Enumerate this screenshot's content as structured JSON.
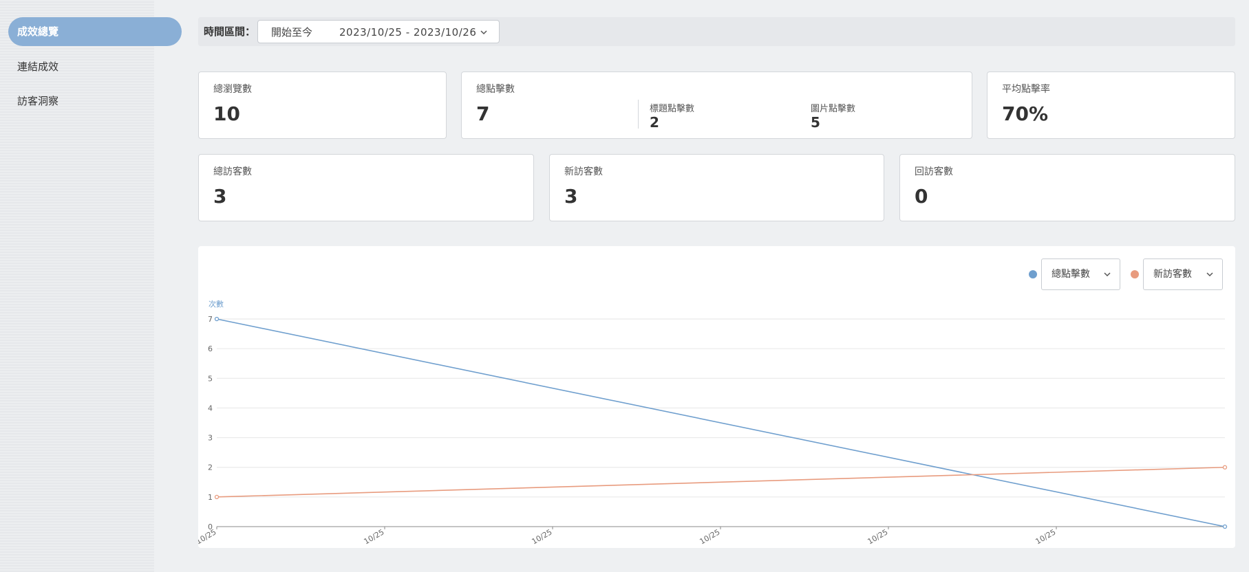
{
  "sidebar": {
    "items": [
      {
        "label": "成效總覽",
        "active": true
      },
      {
        "label": "連結成效",
        "active": false
      },
      {
        "label": "訪客洞察",
        "active": false
      }
    ]
  },
  "filter": {
    "label": "時間區間：",
    "preset": "開始至今",
    "range": "2023/10/25 - 2023/10/26"
  },
  "stats": {
    "total_views": {
      "label": "總瀏覽數",
      "value": "10"
    },
    "total_clicks": {
      "label": "總點擊數",
      "value": "7",
      "title_clicks": {
        "label": "標題點擊數",
        "value": "2"
      },
      "image_clicks": {
        "label": "圖片點擊數",
        "value": "5"
      }
    },
    "avg_ctr": {
      "label": "平均點擊率",
      "value": "70%"
    },
    "total_visitors": {
      "label": "總訪客數",
      "value": "3"
    },
    "new_visitors": {
      "label": "新訪客數",
      "value": "3"
    },
    "returning_visitors": {
      "label": "回訪客數",
      "value": "0"
    }
  },
  "chart_controls": {
    "metric_a": {
      "label": "總點擊數",
      "color": "#6f9fce"
    },
    "metric_b": {
      "label": "新訪客數",
      "color": "#e89b7e"
    }
  },
  "chart_data": {
    "type": "line",
    "ylabel": "次數",
    "ylim": [
      0,
      7
    ],
    "yticks": [
      0,
      1,
      2,
      3,
      4,
      5,
      6,
      7
    ],
    "x_tick_labels": [
      "10/25",
      "10/25",
      "10/25",
      "10/25",
      "10/25",
      "10/25"
    ],
    "x": [
      0,
      1
    ],
    "series": [
      {
        "name": "總點擊數",
        "color": "#6f9fce",
        "values": [
          7,
          0
        ]
      },
      {
        "name": "新訪客數",
        "color": "#e89b7e",
        "values": [
          1,
          2
        ]
      }
    ],
    "grid": true
  }
}
